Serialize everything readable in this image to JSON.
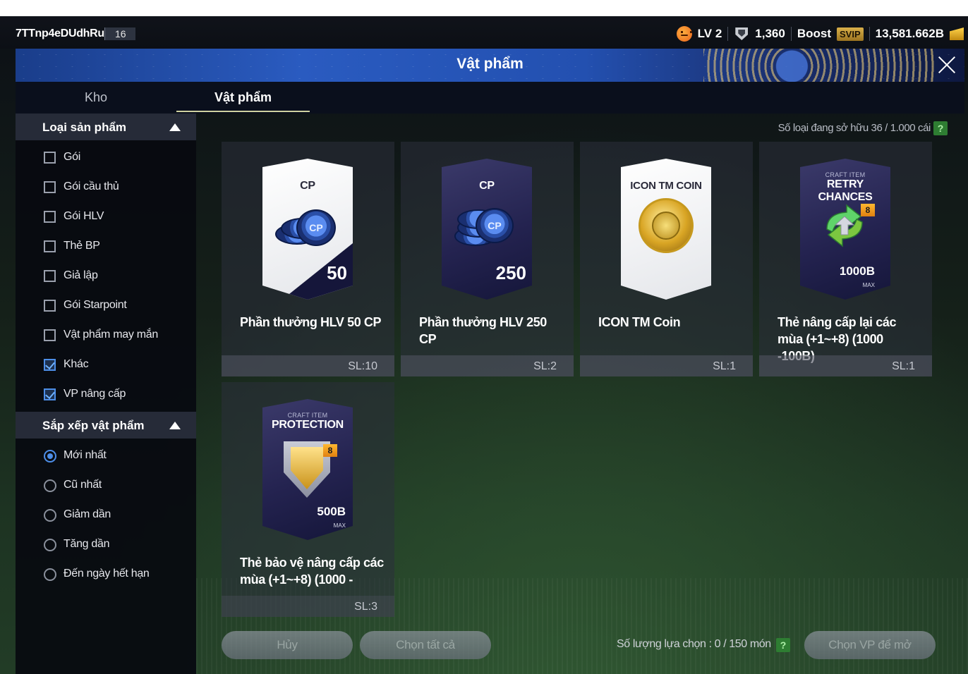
{
  "hud": {
    "player_name": "7TTnp4eDUdhRu",
    "player_level": "16",
    "level_label": "LV 2",
    "trophy_value": "1,360",
    "boost_label": "Boost",
    "svip_label": "SVIP",
    "currency_value": "13,581.662B"
  },
  "window": {
    "title": "Vật phẩm",
    "close_icon": "close-icon"
  },
  "tabs": [
    {
      "label": "Kho",
      "active": false
    },
    {
      "label": "Vật phẩm",
      "active": true
    }
  ],
  "sidebar": {
    "product_type": {
      "title": "Loại sản phẩm",
      "options": [
        {
          "label": "Gói",
          "checked": false
        },
        {
          "label": "Gói cầu thủ",
          "checked": false
        },
        {
          "label": "Gói HLV",
          "checked": false
        },
        {
          "label": "Thẻ BP",
          "checked": false
        },
        {
          "label": "Giả lập",
          "checked": false
        },
        {
          "label": "Gói Starpoint",
          "checked": false
        },
        {
          "label": "Vật phẩm may mắn",
          "checked": false
        },
        {
          "label": "Khác",
          "checked": true
        },
        {
          "label": "VP nâng cấp",
          "checked": true
        }
      ]
    },
    "sort": {
      "title": "Sắp xếp vật phẩm",
      "options": [
        {
          "label": "Mới nhất",
          "selected": true
        },
        {
          "label": "Cũ nhất",
          "selected": false
        },
        {
          "label": "Giảm dần",
          "selected": false
        },
        {
          "label": "Tăng dần",
          "selected": false
        },
        {
          "label": "Đến ngày hết hạn",
          "selected": false
        }
      ]
    }
  },
  "main": {
    "owned_text": "Số loại đang sở hữu  36 / 1.000 cái",
    "help_label": "?",
    "items": [
      {
        "art_top": "CP",
        "art_value": "50",
        "name": "Phần thưởng HLV 50 CP",
        "qty": "SL:10"
      },
      {
        "art_top": "CP",
        "art_value": "250",
        "name": "Phần thưởng HLV 250 CP",
        "qty": "SL:2"
      },
      {
        "art_top": "ICON TM COIN",
        "art_value": "",
        "name": "ICON TM Coin",
        "qty": "SL:1"
      },
      {
        "art_small": "CRAFT ITEM",
        "art_top": "RETRY CHANCES",
        "art_badge": "8",
        "art_value": "1000B",
        "art_max": "MAX",
        "name": "Thẻ nâng cấp lại các mùa (+1~+8) (1000 -100B)",
        "qty": "SL:1"
      },
      {
        "art_small": "CRAFT ITEM",
        "art_top": "PROTECTION",
        "art_badge": "8",
        "art_value": "500B",
        "art_max": "MAX",
        "name": "Thẻ bảo vệ nâng cấp các mùa (+1~+8) (1000 -",
        "qty": "SL:3"
      }
    ]
  },
  "footer": {
    "cancel_label": "Hủy",
    "select_all_label": "Chọn tất cả",
    "selection_count": "Số lượng lựa chọn : 0 / 150 món",
    "help_label": "?",
    "open_label": "Chọn VP để mở"
  }
}
